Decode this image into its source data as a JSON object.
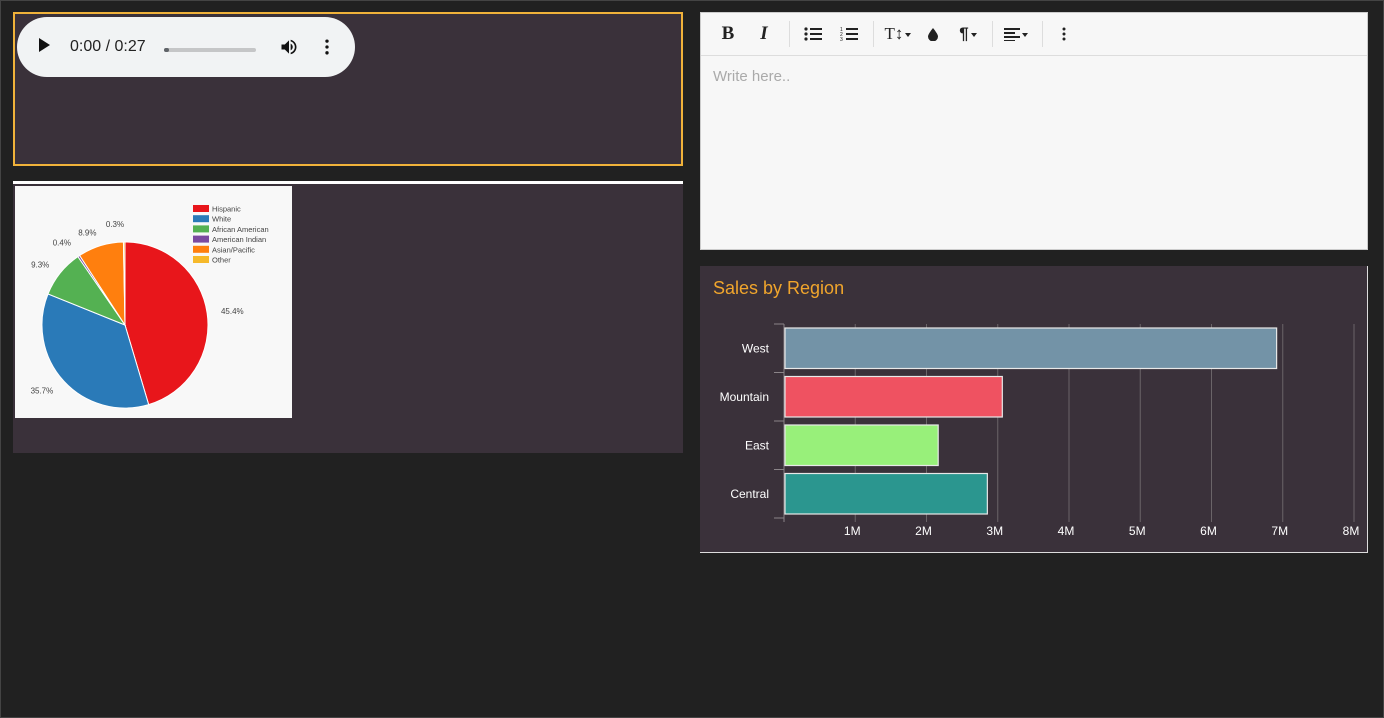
{
  "audio_player": {
    "time_display": "0:00 / 0:27",
    "progress": 0.05,
    "icons": [
      "play-icon",
      "volume-icon",
      "more-vert-icon"
    ]
  },
  "pie_image": {
    "chart_data": {
      "type": "pie",
      "slices": [
        {
          "label": "Hispanic",
          "value": 45.4,
          "value_label": "45.4%",
          "color": "#e8161b"
        },
        {
          "label": "White",
          "value": 35.7,
          "value_label": "35.7%",
          "color": "#2a7ab8"
        },
        {
          "label": "African American",
          "value": 9.3,
          "value_label": "9.3%",
          "color": "#54b152"
        },
        {
          "label": "American Indian",
          "value": 0.4,
          "value_label": "0.4%",
          "color": "#7b4aa0"
        },
        {
          "label": "Asian/Pacific",
          "value": 8.9,
          "value_label": "8.9%",
          "color": "#ff7f0e"
        },
        {
          "label": "Other",
          "value": 0.3,
          "value_label": "0.3%",
          "color": "#f6b92b"
        }
      ],
      "legend_position": "top-right"
    }
  },
  "editor": {
    "placeholder": "Write here..",
    "toolbar": {
      "bold": "B",
      "italic": "I",
      "font_size": "T↕",
      "paragraph": "¶"
    }
  },
  "bar_chart": {
    "title": "Sales by Region",
    "title_color": "#f0a52c",
    "chart_data": {
      "type": "bar",
      "orientation": "horizontal",
      "title": "Sales by Region",
      "categories": [
        "West",
        "Mountain",
        "East",
        "Central"
      ],
      "values": [
        6900000,
        3050000,
        2150000,
        2840000
      ],
      "colors": [
        "#7393a7",
        "#ef5261",
        "#98f07a",
        "#2b968f"
      ],
      "xlim": [
        0,
        8000000
      ],
      "xticks": [
        1000000,
        2000000,
        3000000,
        4000000,
        5000000,
        6000000,
        7000000,
        8000000
      ],
      "xtick_labels": [
        "1M",
        "2M",
        "3M",
        "4M",
        "5M",
        "6M",
        "7M",
        "8M"
      ],
      "grid": true
    }
  }
}
